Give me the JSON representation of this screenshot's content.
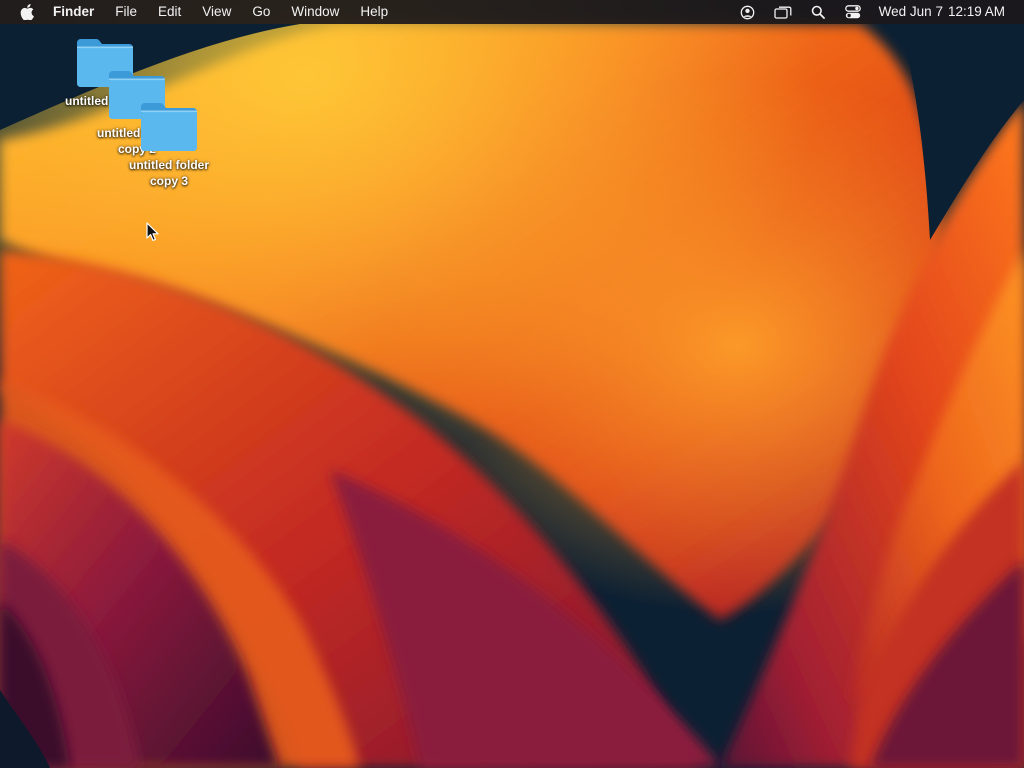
{
  "menubar": {
    "apple_icon": "apple-logo-icon",
    "app_name": "Finder",
    "items": [
      "File",
      "Edit",
      "View",
      "Go",
      "Window",
      "Help"
    ],
    "status_icons": [
      "user-account-icon",
      "screen-mirroring-icon",
      "spotlight-search-icon",
      "control-center-icon"
    ],
    "date": "Wed Jun 7",
    "time": "12:19 AM"
  },
  "desktop": {
    "folders": [
      {
        "label": "untitled folder",
        "icon": "folder-icon"
      },
      {
        "label": "untitled folder copy 2",
        "icon": "folder-icon"
      },
      {
        "label": "untitled folder copy 3",
        "icon": "folder-icon"
      }
    ],
    "folder_color": "#5bb8ee",
    "cursor": "arrow-cursor-icon"
  },
  "wallpaper": {
    "name": "macOS Ventura",
    "colors": [
      "#ff9a1c",
      "#ee4a12",
      "#b01f2a",
      "#6a1240",
      "#0c2033"
    ]
  }
}
